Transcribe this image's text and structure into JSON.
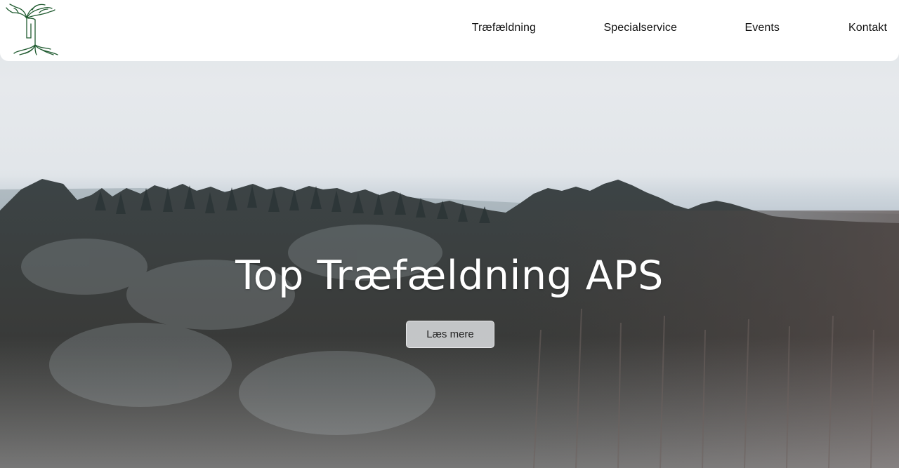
{
  "brand": {
    "logo_icon": "tree-roots-logo"
  },
  "nav": {
    "items": [
      {
        "label": "Træfældning"
      },
      {
        "label": "Specialservice"
      },
      {
        "label": "Events"
      },
      {
        "label": "Kontakt"
      }
    ]
  },
  "hero": {
    "title": "Top Træfældning APS",
    "cta_label": "Læs mere",
    "background": "winter forest aerial video"
  },
  "colors": {
    "header_bg": "#ffffff",
    "logo_green": "#1f5a2f",
    "title_text": "#ffffff",
    "cta_bg": "#e2e4e6"
  }
}
